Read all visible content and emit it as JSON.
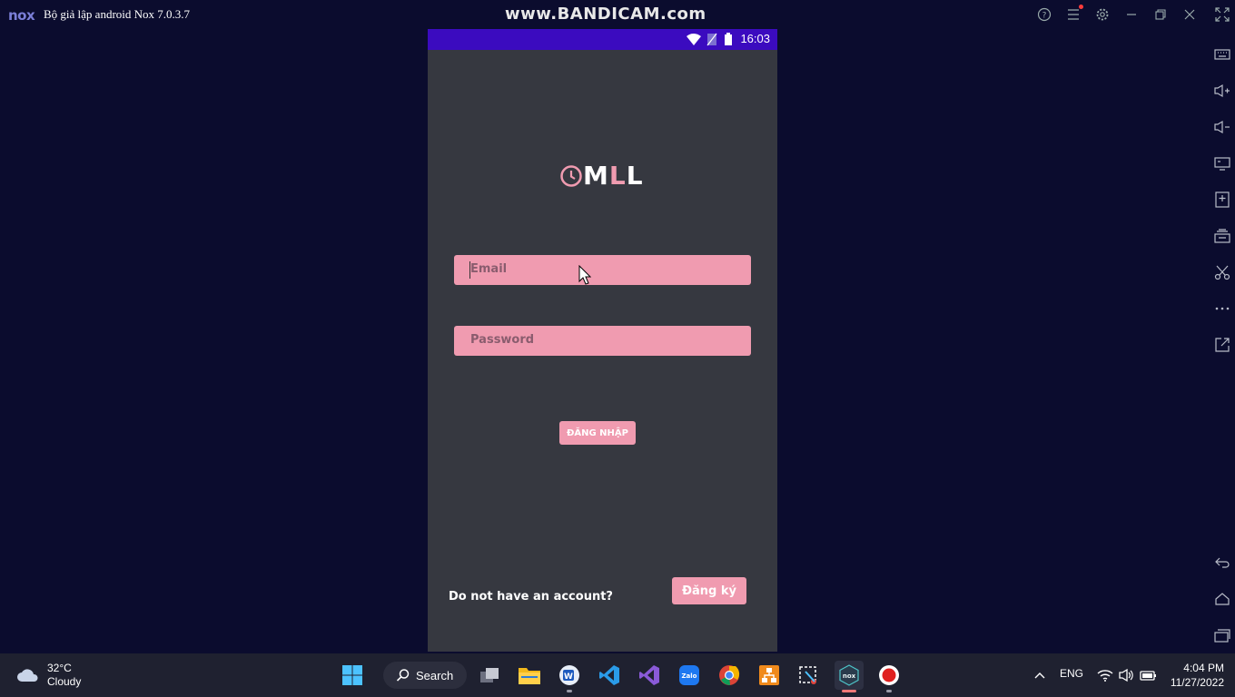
{
  "titlebar": {
    "logo": "nox",
    "title": "Bộ giả lập android Nox 7.0.3.7",
    "watermark": "www.BANDICAM.com",
    "icons": [
      "help-icon",
      "menu-icon",
      "settings-icon",
      "minimize-icon",
      "restore-icon",
      "close-icon",
      "fullscreen-icon"
    ]
  },
  "sidebar": {
    "icons": [
      "keyboard-icon",
      "volume-up-icon",
      "volume-down-icon",
      "screen-icon",
      "add-apk-icon",
      "multi-instance-icon",
      "scissors-icon",
      "more-icon",
      "external-link-icon",
      "back-icon",
      "home-icon",
      "recents-icon"
    ]
  },
  "phone": {
    "status": {
      "time": "16:03"
    },
    "logo": {
      "part1": "M",
      "part2": "L",
      "part3": "L"
    },
    "email": {
      "placeholder": "Email"
    },
    "password": {
      "placeholder": "Password"
    },
    "login_button": "ĐĂNG NHẬP",
    "signup_prompt": "Do not have an account?",
    "signup_button": "Đăng ký"
  },
  "taskbar": {
    "weather": {
      "temp": "32°C",
      "condition": "Cloudy"
    },
    "search_label": "Search",
    "language": "ENG",
    "time": "4:04 PM",
    "date": "11/27/2022"
  },
  "colors": {
    "desktop_bg": "#0b0c2e",
    "phone_bg": "#363840",
    "status_bar": "#3b0bbf",
    "accent_pink": "#f09bb0",
    "taskbar_bg": "#1f2130"
  }
}
